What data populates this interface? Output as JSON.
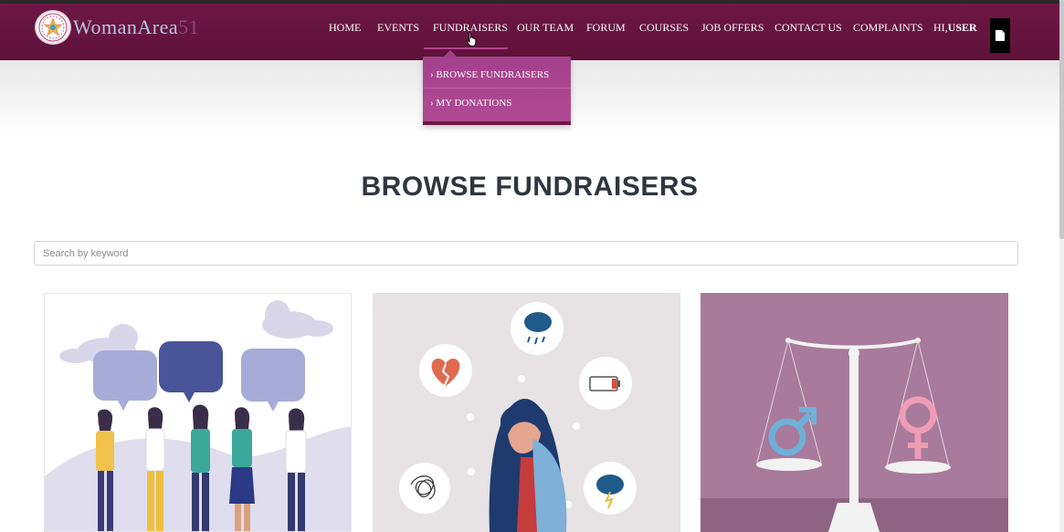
{
  "header": {
    "logo": {
      "text": "WomanArea",
      "number": "51"
    },
    "nav": [
      {
        "id": "home",
        "label": "HOME"
      },
      {
        "id": "events",
        "label": "EVENTS"
      },
      {
        "id": "fundraisers",
        "label": "FUNDRAISERS",
        "active": true
      },
      {
        "id": "our-team",
        "label": "OUR TEAM"
      },
      {
        "id": "forum",
        "label": "FORUM"
      },
      {
        "id": "courses",
        "label": "COURSES"
      },
      {
        "id": "job-offers",
        "label": "JOB OFFERS"
      },
      {
        "id": "contact-us",
        "label": "CONTACT US"
      },
      {
        "id": "complaints",
        "label": "COMPLAINTS"
      }
    ],
    "greeting_prefix": "HI,",
    "greeting_user": "USER"
  },
  "dropdown": {
    "items": [
      {
        "label": "› BROWSE FUNDRAISERS"
      },
      {
        "label": "› MY DONATIONS"
      }
    ]
  },
  "main": {
    "title": "BROWSE FUNDRAISERS",
    "search": {
      "placeholder": "Search by keyword",
      "value": ""
    }
  },
  "cards": [
    {
      "illustration": "women-talking-speech-bubbles"
    },
    {
      "illustration": "sad-woman-emotions"
    },
    {
      "illustration": "gender-equality-scale"
    }
  ],
  "colors": {
    "navbar": "#6e1746",
    "dropdown": "#a4418c",
    "title": "#2f3640",
    "card2_bg": "#e7e2e4",
    "card3_bg": "#a87a9b"
  }
}
